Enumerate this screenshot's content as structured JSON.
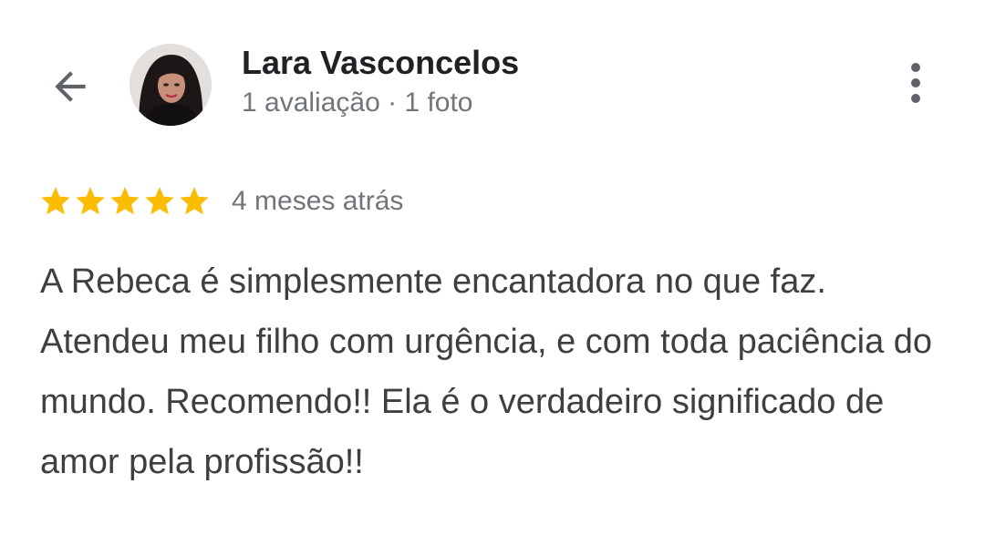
{
  "header": {
    "back_icon": "arrow-back-icon",
    "more_icon": "more-vert-icon",
    "user": {
      "name": "Lara Vasconcelos",
      "meta": "1 avaliação · 1 foto"
    }
  },
  "review": {
    "rating": 5,
    "rating_max": 5,
    "star_color": "#fbbc04",
    "date": "4 meses atrás",
    "text": "A Rebeca é simplesmente encantadora no que faz. Atendeu meu filho com urgência, e com toda paciência do mundo. Recomendo!! Ela é o verdadeiro significado de amor pela profissão!!"
  }
}
